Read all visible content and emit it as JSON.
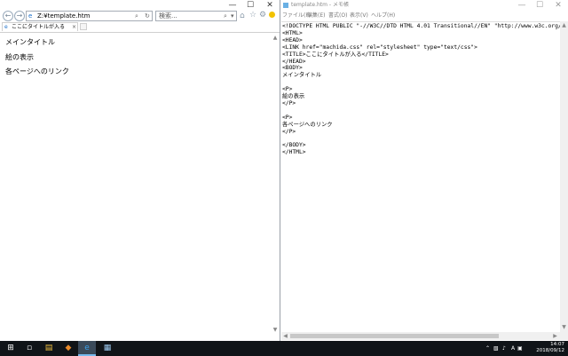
{
  "browser": {
    "address": "Z:¥template.htm",
    "search_placeholder": "検索...",
    "tab_title": "ここにタイトルが入る",
    "content_lines": [
      "メインタイトル",
      "絵の表示",
      "各ページへのリンク"
    ]
  },
  "notepad": {
    "title": "template.htm - メモ帳",
    "menu": [
      "ファイル(F)",
      "編集(E)",
      "書式(O)",
      "表示(V)",
      "ヘルプ(H)"
    ],
    "text": "<!DOCTYPE HTML PUBLIC \"-//W3C//DTD HTML 4.01 Transitional//EN\" \"http://www.w3c.org/TR/199\n<HTML>\n<HEAD>\n<LINK href=\"machida.css\" rel=\"stylesheet\" type=\"text/css\">\n<TITLE>ここにタイトルが入る</TITLE>\n</HEAD>\n<BODY>\nメインタイトル\n\n<P>\n絵の表示\n</P>\n\n<P>\n各ページへのリンク\n</P>\n\n</BODY>\n</HTML>"
  },
  "taskbar": {
    "ime": "A",
    "time": "14:07",
    "date": "2018/09/12"
  }
}
